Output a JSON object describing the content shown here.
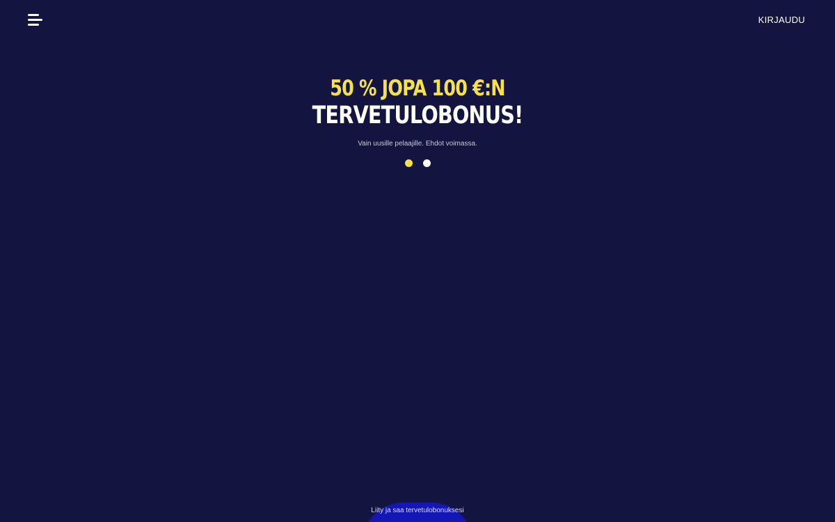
{
  "header": {
    "menu_icon": "hamburger-menu-icon",
    "login_label": "KIRJAUDU"
  },
  "hero": {
    "headline_line1": "50 % JOPA 100 €:N",
    "headline_line2": "TERVETULOBONUS!",
    "terms": "Vain uusille pelaajille. Ehdot voimassa.",
    "carousel": {
      "total_slides": 2,
      "active_slide": 1
    }
  },
  "cta": {
    "label": "Liity ja saa tervetulobonuksesi"
  },
  "colors": {
    "background": "#131540",
    "accent_yellow": "#f7e04a",
    "cta_blue": "#1417b6",
    "text_white": "#ffffff"
  }
}
